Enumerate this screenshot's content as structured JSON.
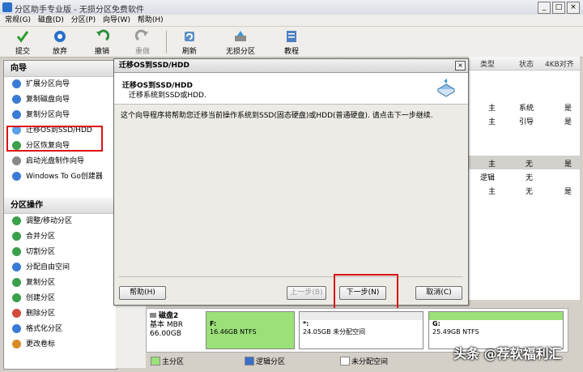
{
  "window": {
    "title": "分区助手专业版 - 无损分区免费软件"
  },
  "menu": {
    "items": [
      "常规(G)",
      "磁盘(D)",
      "分区(P)",
      "向导(W)",
      "帮助(H)"
    ]
  },
  "toolbar": {
    "items": [
      {
        "label": "提交",
        "icon": "checkmark-icon"
      },
      {
        "label": "放弃",
        "icon": "discard-icon"
      },
      {
        "label": "撤销",
        "icon": "undo-icon"
      },
      {
        "label": "重做",
        "icon": "redo-icon"
      },
      {
        "label": "刷新",
        "icon": "refresh-icon"
      },
      {
        "label": "无损分区",
        "icon": "lossless-partition-icon"
      },
      {
        "label": "教程",
        "icon": "tutorial-icon"
      }
    ]
  },
  "wizard": {
    "heading": "向导",
    "items": [
      "扩展分区向导",
      "复制磁盘向导",
      "复制分区向导",
      "迁移OS到SSD/HDD",
      "分区恢复向导",
      "启动光盘制作向导",
      "Windows To Go创建器"
    ]
  },
  "operations": {
    "heading": "分区操作",
    "items": [
      "调整/移动分区",
      "合并分区",
      "切割分区",
      "分配自由空间",
      "复制分区",
      "创建分区",
      "删除分区",
      "格式化分区",
      "更改卷标"
    ]
  },
  "grid": {
    "headers": [
      "类型",
      "状态",
      "4KB对齐"
    ],
    "rows": [
      {
        "type": "主",
        "status": "系统",
        "align": "是"
      },
      {
        "type": "主",
        "status": "引导",
        "align": "是"
      },
      {
        "type": "主",
        "status": "无",
        "align": "是"
      },
      {
        "type": "逻辑",
        "status": "无",
        "align": ""
      },
      {
        "type": "主",
        "status": "无",
        "align": "是"
      }
    ]
  },
  "dialog": {
    "title": "迁移OS到SSD/HDD",
    "header_title": "迁移OS到SSD/HDD",
    "header_sub": "迁移系统到SSD或HDD.",
    "body": "这个向导程序将帮助您迁移当前操作系统到SSD(固态硬盘)或HDD(普通硬盘). 请点击下一步继续.",
    "help": "帮助(H)",
    "back": "上一步(B)",
    "next": "下一步(N)",
    "cancel": "取消(C)"
  },
  "disk": {
    "name": "磁盘2",
    "type": "基本 MBR",
    "size": "66.00GB",
    "partitions": [
      {
        "name": "F:",
        "info": "16.46GB NTFS"
      },
      {
        "name": "*:",
        "info": "24.05GB 未分配空间"
      },
      {
        "name": "G:",
        "info": "25.49GB NTFS"
      }
    ]
  },
  "legend": {
    "primary": "主分区",
    "logical": "逻辑分区",
    "unallocated": "未分配空间"
  },
  "watermark": "头条 @荐软福利汇",
  "colors": {
    "accent": "#2a6fc9",
    "highlight": "#dd1111",
    "primary_partition": "#9be079",
    "unallocated": "#ffffff"
  }
}
